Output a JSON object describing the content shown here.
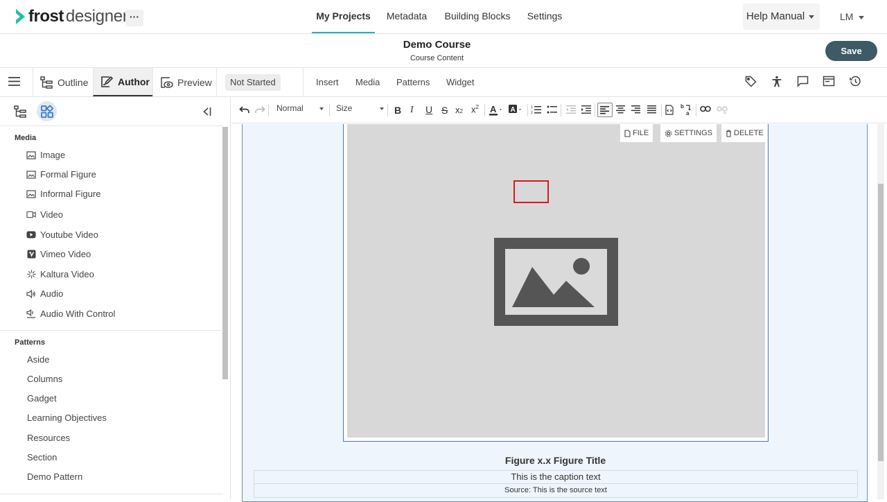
{
  "app": {
    "logo_text_bold": "frost",
    "logo_text_light": "designer",
    "more_label": "···"
  },
  "topnav": {
    "tabs": [
      {
        "label": "My Projects",
        "active": true
      },
      {
        "label": "Metadata"
      },
      {
        "label": "Building Blocks"
      },
      {
        "label": "Settings"
      }
    ],
    "help_label": "Help Manual",
    "user_initials": "LM"
  },
  "course": {
    "title": "Demo Course",
    "subtitle": "Course Content",
    "save_label": "Save"
  },
  "modes": {
    "outline_label": "Outline",
    "author_label": "Author",
    "preview_label": "Preview",
    "status_label": "Not Started",
    "menu": [
      "Insert",
      "Media",
      "Patterns",
      "Widget"
    ]
  },
  "sidebar": {
    "media_heading": "Media",
    "media_items": [
      {
        "label": "Image",
        "icon": "image-icon"
      },
      {
        "label": "Formal Figure",
        "icon": "image-icon"
      },
      {
        "label": "Informal Figure",
        "icon": "image-icon"
      },
      {
        "label": "Video",
        "icon": "video-icon"
      },
      {
        "label": "Youtube Video",
        "icon": "youtube-icon"
      },
      {
        "label": "Vimeo Video",
        "icon": "vimeo-icon"
      },
      {
        "label": "Kaltura Video",
        "icon": "kaltura-icon"
      },
      {
        "label": "Audio",
        "icon": "audio-icon"
      },
      {
        "label": "Audio With Control",
        "icon": "audio-control-icon"
      }
    ],
    "patterns_heading": "Patterns",
    "pattern_items": [
      "Aside",
      "Columns",
      "Gadget",
      "Learning Objectives",
      "Resources",
      "Section",
      "Demo Pattern"
    ]
  },
  "toolbar": {
    "format_value": "Normal",
    "size_value": "Size"
  },
  "figure": {
    "file_label": "FILE",
    "settings_label": "SETTINGS",
    "delete_label": "DELETE",
    "title": "Figure x.x Figure Title",
    "caption": "This is the caption text",
    "source": "Source:  This is the source text"
  },
  "colors": {
    "accent": "#21b2c2",
    "save_bg": "#3e5a64",
    "block_bg": "#eef5fc",
    "highlight": "#d9161c"
  }
}
